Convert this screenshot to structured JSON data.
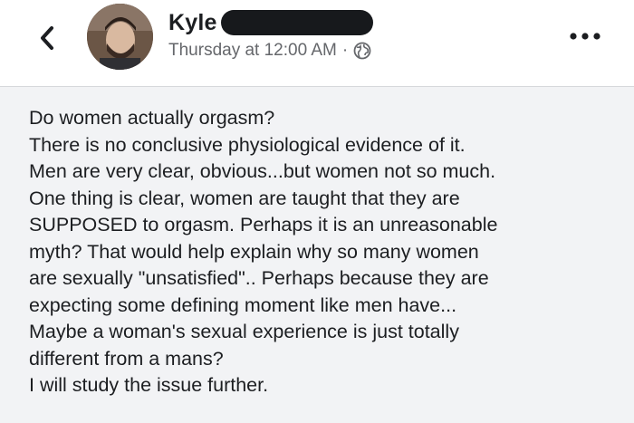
{
  "post": {
    "author": "Kyle",
    "timestamp": "Thursday at 12:00 AM",
    "separator": "·",
    "privacy_icon": "globe-icon",
    "back_icon": "chevron-left-icon",
    "more_icon": "more-horizontal-icon",
    "lines": [
      "Do women actually orgasm?",
      "There is no conclusive physiological evidence of it.",
      "Men are very clear, obvious...but women not so much.",
      "One thing is clear, women are taught that they are",
      "SUPPOSED to orgasm.  Perhaps it is an unreasonable",
      "myth?  That would help explain why so many women",
      "are sexually \"unsatisfied\".. Perhaps because they are",
      "expecting some defining moment like men have...",
      "Maybe a woman's sexual experience is just totally",
      "different from a mans?",
      "I will study the issue further."
    ]
  },
  "colors": {
    "background": "#ffffff",
    "post_background": "#f2f3f5",
    "text": "#1c1e21",
    "meta_text": "#65676b",
    "redaction": "#17191c"
  }
}
